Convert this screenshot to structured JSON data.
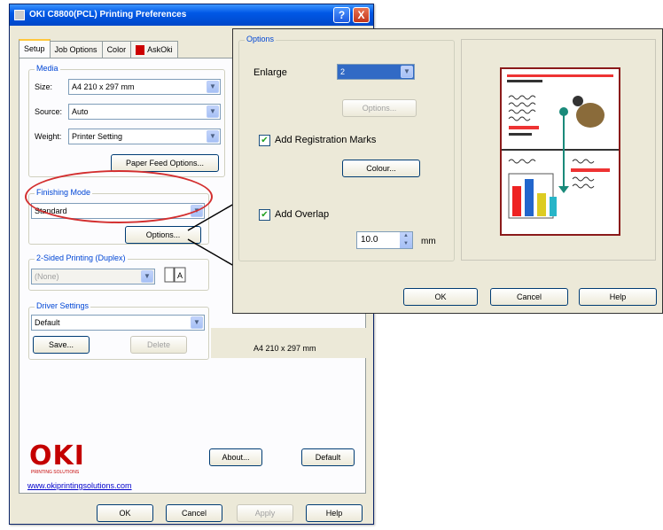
{
  "window": {
    "title": "OKI C8800(PCL) Printing Preferences",
    "help": "?",
    "close": "X"
  },
  "tabs": [
    {
      "label": "Setup"
    },
    {
      "label": "Job Options"
    },
    {
      "label": "Color"
    },
    {
      "label": "AskOki"
    }
  ],
  "media": {
    "group": "Media",
    "size_label": "Size:",
    "size_value": "A4 210 x 297 mm",
    "source_label": "Source:",
    "source_value": "Auto",
    "weight_label": "Weight:",
    "weight_value": "Printer Setting",
    "paper_feed_button": "Paper Feed Options..."
  },
  "finishing": {
    "group": "Finishing Mode",
    "value": "Standard",
    "options_button": "Options..."
  },
  "duplex": {
    "group": "2-Sided Printing (Duplex)",
    "value": "(None)"
  },
  "driver": {
    "group": "Driver Settings",
    "value": "Default",
    "save_button": "Save...",
    "delete_button": "Delete"
  },
  "preview_caption": "A4 210 x 297 mm",
  "branding": {
    "logo": "OKI",
    "tagline": "PRINTING SOLUTIONS",
    "url": "www.okiprintingsolutions.com"
  },
  "main_buttons": {
    "about": "About...",
    "default": "Default",
    "ok": "OK",
    "cancel": "Cancel",
    "apply": "Apply",
    "help": "Help"
  },
  "options_dialog": {
    "group": "Options",
    "enlarge_label": "Enlarge",
    "enlarge_value": "2",
    "options_button": "Options...",
    "registration_label": "Add Registration Marks",
    "registration_checked": true,
    "colour_button": "Colour...",
    "overlap_label": "Add Overlap",
    "overlap_checked": true,
    "overlap_value": "10.0",
    "overlap_unit": "mm",
    "ok": "OK",
    "cancel": "Cancel",
    "help": "Help"
  },
  "colors": {
    "accent": "#0058e6",
    "highlight_oval": "#d32f2f",
    "oki_red": "#c40000"
  }
}
